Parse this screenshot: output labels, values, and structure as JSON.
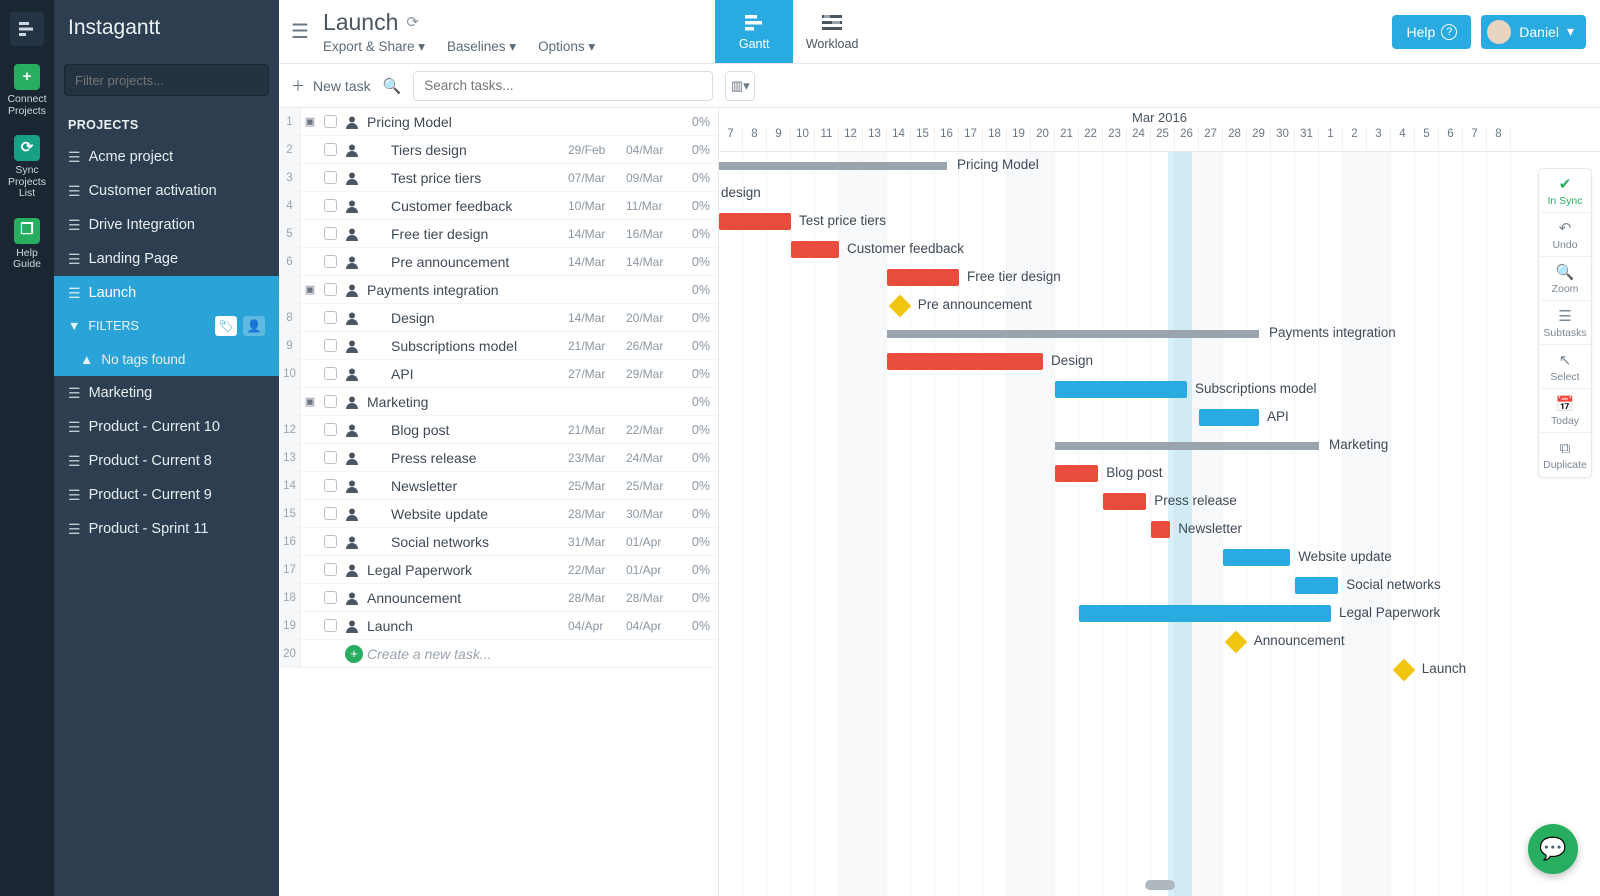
{
  "app": {
    "brand": "Instagantt"
  },
  "rail": {
    "connect": "Connect\nProjects",
    "sync": "Sync\nProjects\nList",
    "help": "Help\nGuide"
  },
  "sidebar": {
    "filter_placeholder": "Filter projects...",
    "heading": "PROJECTS",
    "projects": [
      "Acme project",
      "Customer activation",
      "Drive Integration",
      "Landing Page",
      "Launch",
      "Marketing",
      "Product - Current 10",
      "Product - Current 8",
      "Product - Current 9",
      "Product - Sprint 11"
    ],
    "selected": "Launch",
    "filters_label": "FILTERS",
    "no_tags": "No tags found"
  },
  "header": {
    "title": "Launch",
    "menus": [
      "Export & Share ▾",
      "Baselines ▾",
      "Options ▾"
    ],
    "views": {
      "gantt": "Gantt",
      "workload": "Workload"
    },
    "help": "Help",
    "user": "Daniel"
  },
  "toolbar": {
    "new_task": "New task",
    "search_placeholder": "Search tasks..."
  },
  "timeline": {
    "month": "Mar 2016",
    "days": [
      "7",
      "8",
      "9",
      "10",
      "11",
      "12",
      "13",
      "14",
      "15",
      "16",
      "17",
      "18",
      "19",
      "20",
      "21",
      "22",
      "23",
      "24",
      "25",
      "26",
      "27",
      "28",
      "29",
      "30",
      "31",
      "1",
      "2",
      "3",
      "4",
      "5",
      "6",
      "7",
      "8"
    ]
  },
  "right_tools": [
    "In Sync",
    "Undo",
    "Zoom",
    "Subtasks",
    "Select",
    "Today",
    "Duplicate"
  ],
  "create_task_placeholder": "Create a new task...",
  "rows": [
    {
      "n": 1,
      "kind": "group",
      "name": "Pricing Model",
      "pct": "0%",
      "bar": {
        "type": "sum",
        "s": 0,
        "e": 9.5
      },
      "label": "Pricing Model"
    },
    {
      "n": 2,
      "kind": "sub",
      "name": "Tiers design",
      "d1": "29/Feb",
      "d2": "04/Mar",
      "pct": "0%",
      "label_only": "design"
    },
    {
      "n": 3,
      "kind": "sub",
      "name": "Test price tiers",
      "d1": "07/Mar",
      "d2": "09/Mar",
      "pct": "0%",
      "bar": {
        "type": "red",
        "s": 0,
        "e": 3
      },
      "label": "Test price tiers"
    },
    {
      "n": 4,
      "kind": "sub",
      "name": "Customer feedback",
      "d1": "10/Mar",
      "d2": "11/Mar",
      "pct": "0%",
      "bar": {
        "type": "red",
        "s": 3,
        "e": 5
      },
      "label": "Customer feedback"
    },
    {
      "n": 5,
      "kind": "sub",
      "name": "Free tier design",
      "d1": "14/Mar",
      "d2": "16/Mar",
      "pct": "0%",
      "bar": {
        "type": "red",
        "s": 7,
        "e": 10
      },
      "label": "Free tier design"
    },
    {
      "n": 6,
      "kind": "sub",
      "name": "Pre announcement",
      "d1": "14/Mar",
      "d2": "14/Mar",
      "pct": "0%",
      "bar": {
        "type": "mile",
        "s": 7.2
      },
      "label": "Pre announcement"
    },
    {
      "n": "",
      "kind": "group",
      "name": "Payments integration",
      "pct": "0%",
      "bar": {
        "type": "sum",
        "s": 7,
        "e": 22.5
      },
      "label": "Payments integration",
      "label_side": "r"
    },
    {
      "n": 8,
      "kind": "sub",
      "name": "Design",
      "d1": "14/Mar",
      "d2": "20/Mar",
      "pct": "0%",
      "bar": {
        "type": "red",
        "s": 7,
        "e": 13.5
      },
      "label": "Design"
    },
    {
      "n": 9,
      "kind": "sub",
      "name": "Subscriptions model",
      "d1": "21/Mar",
      "d2": "26/Mar",
      "pct": "0%",
      "bar": {
        "type": "blue",
        "s": 14,
        "e": 19.5
      },
      "label": "Subscriptions model"
    },
    {
      "n": 10,
      "kind": "sub",
      "name": "API",
      "d1": "27/Mar",
      "d2": "29/Mar",
      "pct": "0%",
      "bar": {
        "type": "blue",
        "s": 20,
        "e": 22.5
      },
      "label": "API"
    },
    {
      "n": "",
      "kind": "group",
      "name": "Marketing",
      "pct": "0%",
      "bar": {
        "type": "sum",
        "s": 14,
        "e": 25
      },
      "label": "Marketing",
      "label_side": "r"
    },
    {
      "n": 12,
      "kind": "sub",
      "name": "Blog post",
      "d1": "21/Mar",
      "d2": "22/Mar",
      "pct": "0%",
      "bar": {
        "type": "red",
        "s": 14,
        "e": 15.8
      },
      "label": "Blog post"
    },
    {
      "n": 13,
      "kind": "sub",
      "name": "Press release",
      "d1": "23/Mar",
      "d2": "24/Mar",
      "pct": "0%",
      "bar": {
        "type": "red",
        "s": 16,
        "e": 17.8
      },
      "label": "Press release"
    },
    {
      "n": 14,
      "kind": "sub",
      "name": "Newsletter",
      "d1": "25/Mar",
      "d2": "25/Mar",
      "pct": "0%",
      "bar": {
        "type": "red",
        "s": 18,
        "e": 18.8
      },
      "label": "Newsletter"
    },
    {
      "n": 15,
      "kind": "sub",
      "name": "Website update",
      "d1": "28/Mar",
      "d2": "30/Mar",
      "pct": "0%",
      "bar": {
        "type": "blue",
        "s": 21,
        "e": 23.8
      },
      "label": "Website update"
    },
    {
      "n": 16,
      "kind": "sub",
      "name": "Social networks",
      "d1": "31/Mar",
      "d2": "01/Apr",
      "pct": "0%",
      "bar": {
        "type": "blue",
        "s": 24,
        "e": 25.8
      },
      "label": "Social networks"
    },
    {
      "n": 17,
      "kind": "task",
      "name": "Legal Paperwork",
      "d1": "22/Mar",
      "d2": "01/Apr",
      "pct": "0%",
      "bar": {
        "type": "blue",
        "s": 15,
        "e": 25.5
      },
      "label": "Legal Paperwork"
    },
    {
      "n": 18,
      "kind": "task",
      "name": "Announcement",
      "d1": "28/Mar",
      "d2": "28/Mar",
      "pct": "0%",
      "bar": {
        "type": "mile",
        "s": 21.2
      },
      "label": "Announcement"
    },
    {
      "n": 19,
      "kind": "task",
      "name": "Launch",
      "d1": "04/Apr",
      "d2": "04/Apr",
      "pct": "0%",
      "bar": {
        "type": "mile",
        "s": 28.2
      },
      "label": "Launch"
    },
    {
      "n": 20,
      "kind": "create"
    }
  ]
}
